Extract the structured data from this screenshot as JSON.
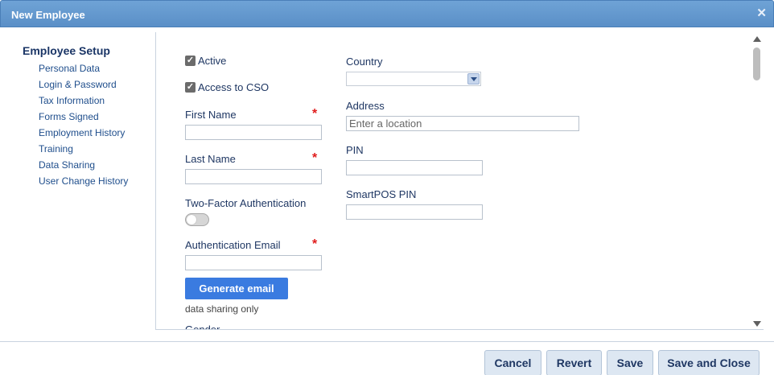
{
  "window": {
    "title": "New Employee",
    "close_icon": "close-icon"
  },
  "sidebar": {
    "heading": "Employee Setup",
    "items": [
      {
        "label": "Personal Data"
      },
      {
        "label": "Login & Password"
      },
      {
        "label": "Tax Information"
      },
      {
        "label": "Forms Signed"
      },
      {
        "label": "Employment History"
      },
      {
        "label": "Training"
      },
      {
        "label": "Data Sharing"
      },
      {
        "label": "User Change History"
      }
    ]
  },
  "form": {
    "active": {
      "label": "Active",
      "checked": true
    },
    "access_cso": {
      "label": "Access to CSO",
      "checked": true
    },
    "first_name": {
      "label": "First Name",
      "value": "",
      "required_mark": "*"
    },
    "last_name": {
      "label": "Last Name",
      "value": "",
      "required_mark": "*"
    },
    "two_factor": {
      "label": "Two-Factor Authentication",
      "enabled": false
    },
    "auth_email": {
      "label": "Authentication Email",
      "value": "",
      "required_mark": "*"
    },
    "generate_email_button": "Generate email",
    "data_sharing_note": "data sharing only",
    "gender": {
      "label": "Gender"
    },
    "country": {
      "label": "Country",
      "value": ""
    },
    "address": {
      "label": "Address",
      "placeholder": "Enter a location",
      "value": ""
    },
    "pin": {
      "label": "PIN",
      "value": ""
    },
    "smartpos_pin": {
      "label": "SmartPOS PIN",
      "value": ""
    }
  },
  "footer": {
    "cancel": "Cancel",
    "revert": "Revert",
    "save": "Save",
    "save_close": "Save and Close"
  },
  "colors": {
    "titlebar": "#5a8fc7",
    "primary_button": "#3a7be0",
    "required": "#e01b1b",
    "footer_button": "#dde7f2"
  }
}
